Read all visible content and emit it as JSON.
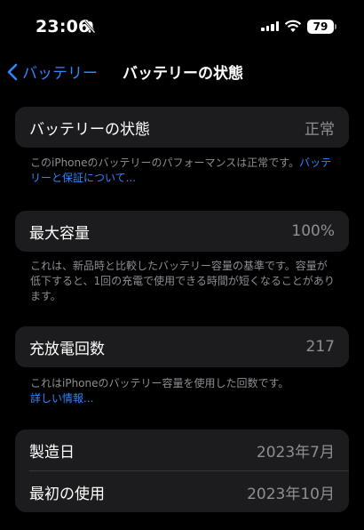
{
  "status_bar": {
    "time": "23:06",
    "battery_level": "79"
  },
  "nav": {
    "back_label": "バッテリー",
    "title": "バッテリーの状態"
  },
  "health": {
    "label": "バッテリーの状態",
    "value": "正常",
    "footnote": "このiPhoneのバッテリーのパフォーマンスは正常です。",
    "link": "バッテリーと保証について..."
  },
  "capacity": {
    "label": "最大容量",
    "value": "100%",
    "footnote": "これは、新品時と比較したバッテリー容量の基準です。容量が低下すると、1回の充電で使用できる時間が短くなることがあります。"
  },
  "cycles": {
    "label": "充放電回数",
    "value": "217",
    "footnote": "これはiPhoneのバッテリー容量を使用した回数です。",
    "link": "詳しい情報..."
  },
  "dates": {
    "manufacture_label": "製造日",
    "manufacture_value": "2023年7月",
    "first_use_label": "最初の使用",
    "first_use_value": "2023年10月"
  },
  "colors": {
    "accent": "#2f86ff",
    "card": "#1c1c1e",
    "secondary_text": "#8e8e93"
  }
}
